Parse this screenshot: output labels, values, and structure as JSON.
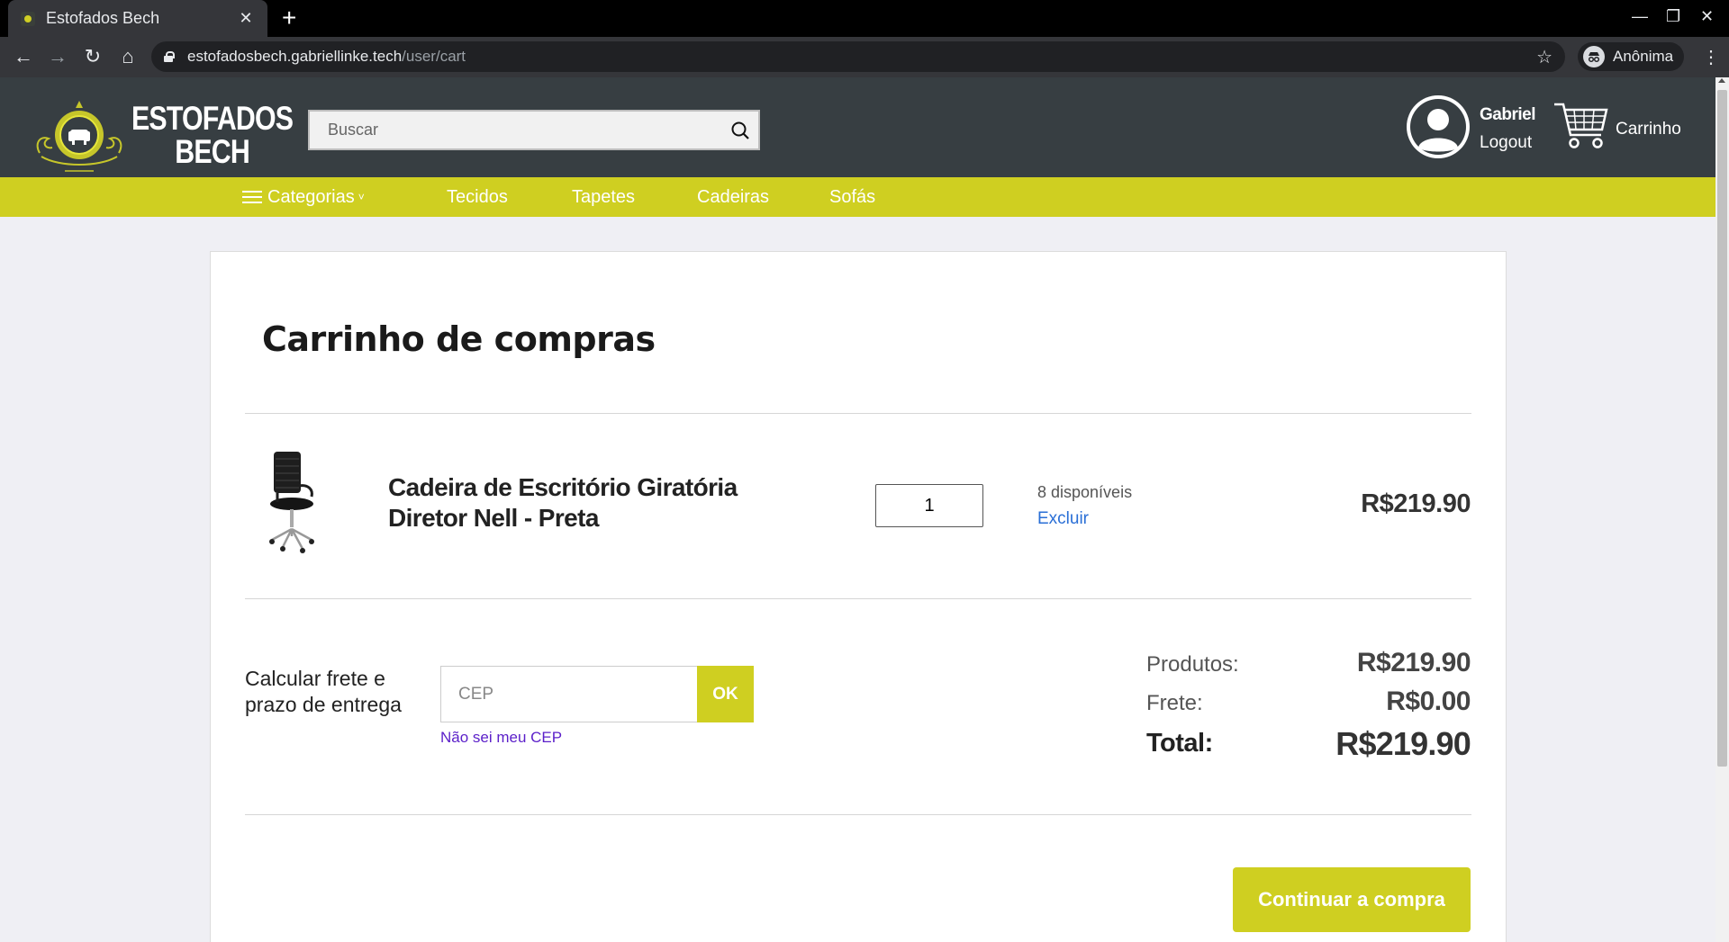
{
  "browser": {
    "tab_title": "Estofados Bech",
    "tab_close": "✕",
    "new_tab": "+",
    "url_host": "estofadosbech.gabriellinke.tech",
    "url_path": "/user/cart",
    "profile_label": "Anônima",
    "back": "←",
    "forward": "→",
    "reload": "↻",
    "home": "⌂",
    "star": "☆",
    "menu": "⋮",
    "minimize": "—",
    "restore": "❐",
    "close": "✕"
  },
  "header": {
    "logo_line1": "ESTOFADOS",
    "logo_line2": "BECH",
    "search_placeholder": "Buscar",
    "user_name": "Gabriel",
    "logout_label": "Logout",
    "cart_label": "Carrinho"
  },
  "nav": {
    "categories_label": "Categorias",
    "categories_chevron": "˅",
    "links": [
      "Tecidos",
      "Tapetes",
      "Cadeiras",
      "Sofás"
    ]
  },
  "cart": {
    "title": "Carrinho de compras",
    "item": {
      "name": "Cadeira de Escritório Giratória Diretor Nell - Preta",
      "quantity": "1",
      "stock": "8 disponíveis",
      "remove_label": "Excluir",
      "price": "R$219.90"
    },
    "shipping": {
      "label": "Calcular frete e prazo de entrega",
      "cep_placeholder": "CEP",
      "ok_label": "OK",
      "unknown_cep_link": "Não sei meu CEP"
    },
    "summary": {
      "products_label": "Produtos:",
      "products_value": "R$219.90",
      "shipping_label": "Frete:",
      "shipping_value": "R$0.00",
      "total_label": "Total:",
      "total_value": "R$219.90"
    },
    "continue_label": "Continuar a compra"
  },
  "colors": {
    "brand_accent": "#cfcf21",
    "header_bg": "#373e42",
    "page_bg": "#efeff4",
    "link_blue": "#2a6fd6",
    "link_purple": "#5b1fc9"
  },
  "icons": {
    "search": "search-icon",
    "user": "user-avatar-icon",
    "cart": "cart-icon",
    "menu": "hamburger-icon",
    "lock": "lock-icon"
  }
}
